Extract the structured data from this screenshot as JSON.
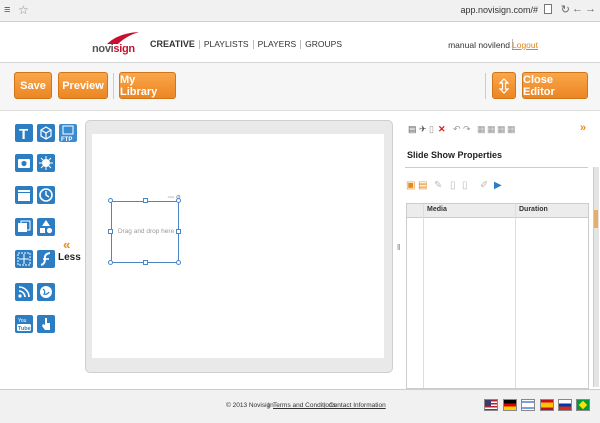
{
  "browser": {
    "url": "app.novisign.com/#"
  },
  "header": {
    "logo": {
      "part1": "novi",
      "part2": "sign"
    },
    "nav": [
      "CREATIVE",
      "PLAYLISTS",
      "PLAYERS",
      "GROUPS"
    ],
    "user": "manual novilend",
    "logout": "Logout"
  },
  "toolbar": {
    "save": "Save",
    "preview": "Preview",
    "library": "My Library",
    "close": "Close Editor"
  },
  "left_panel": {
    "less": "Less",
    "icons": [
      "text-widget-icon",
      "box-widget-icon",
      "ftp-widget-icon",
      "camera-widget-icon",
      "burst-widget-icon",
      "clapper-widget-icon",
      "clock-widget-icon",
      "slideshow-widget-icon",
      "shapes-widget-icon",
      "grid-widget-icon",
      "flash-widget-icon",
      "rss-widget-icon",
      "globe-widget-icon",
      "youtube-widget-icon",
      "touch-widget-icon"
    ]
  },
  "canvas": {
    "placeholder": "Drag and drop here"
  },
  "right_panel": {
    "title": "Slide Show Properties",
    "columns": [
      "Media",
      "Duration"
    ]
  },
  "footer": {
    "copyright": "© 2013 Novisign",
    "terms": "Terms and Conditions",
    "contact": "Contact Information"
  },
  "colors": {
    "accent": "#ec8623",
    "blue": "#2d7dc3"
  }
}
